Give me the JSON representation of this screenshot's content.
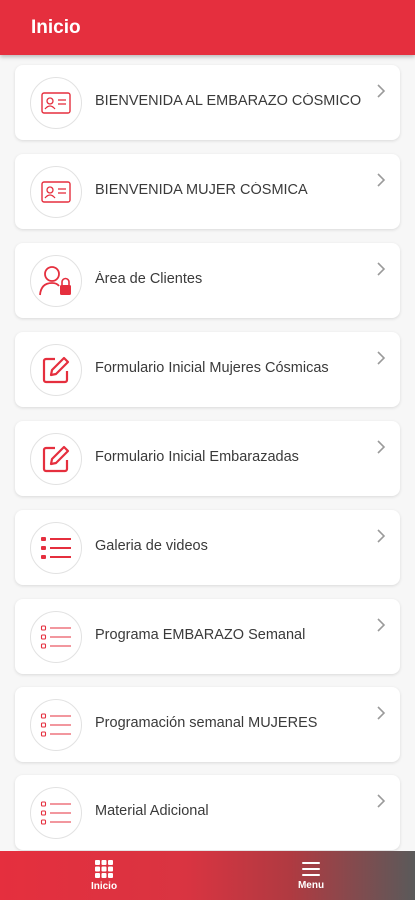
{
  "header": {
    "title": "Inicio"
  },
  "menu_items": [
    {
      "label": "BIENVENIDA AL EMBARAZO CÓSMICO",
      "icon": "id-card-icon"
    },
    {
      "label": "BIENVENIDA MUJER CÓSMICA",
      "icon": "id-card-icon"
    },
    {
      "label": "Área de Clientes",
      "icon": "user-lock-icon"
    },
    {
      "label": "Formulario Inicial Mujeres Cósmicas",
      "icon": "edit-icon"
    },
    {
      "label": "Formulario Inicial Embarazadas",
      "icon": "edit-icon"
    },
    {
      "label": "Galeria de videos",
      "icon": "list-icon"
    },
    {
      "label": "Programa EMBARAZO Semanal",
      "icon": "list-outline-icon"
    },
    {
      "label": "Programación semanal MUJERES",
      "icon": "list-outline-icon"
    },
    {
      "label": "Material Adicional",
      "icon": "list-outline-icon"
    }
  ],
  "bottom_nav": {
    "home_label": "Inicio",
    "menu_label": "Menu"
  },
  "colors": {
    "accent": "#e52f3e",
    "icon_stroke": "#e52f3e",
    "text": "#3a3a3a"
  }
}
